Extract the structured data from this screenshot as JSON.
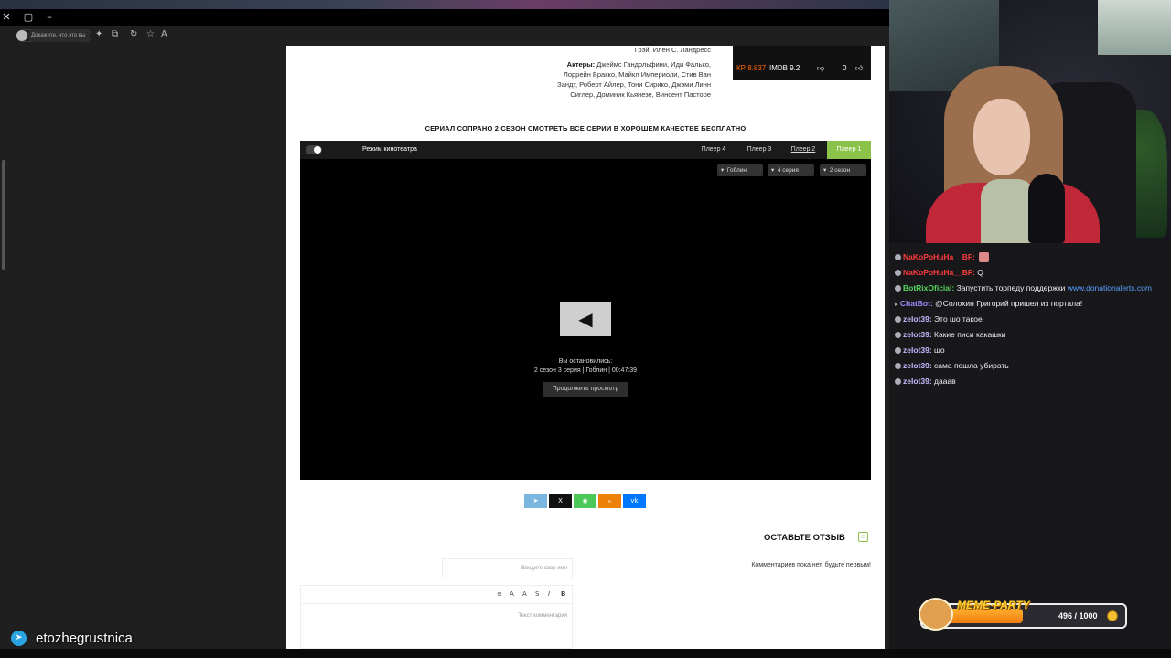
{
  "browser": {
    "address_pill": "Докажите, что это вы",
    "window_close": "✕",
    "window_restore": "▢",
    "window_minimize": "–"
  },
  "movie": {
    "director_line": "Грэй, Илен С. Ландресс",
    "actors_label": "Актеры:",
    "actors_line1": "Джеймс Гандольфини, Иди Фалько,",
    "actors_line2": "Лоррейн Бракко, Майкл Империоли, Стив Ван",
    "actors_line3": "Зандт, Роберт Айлер, Тони Сирико, Джэми Линн",
    "actors_line4": "Сиглер, Доминик Кьянезе, Винсент Пасторе",
    "ratings": {
      "likes": "0",
      "imdb": "IMDB 9.2",
      "kp": "КР 8.837"
    }
  },
  "section_title": "СЕРИАЛ СОПРАНО 2 СЕЗОН СМОТРЕТЬ ВСЕ СЕРИИ В ХОРОШЕМ КАЧЕСТВЕ БЕСПЛАТНО",
  "player": {
    "tabs": [
      "Плеер 1",
      "Плеер 2",
      "Плеер 3",
      "Плеер 4"
    ],
    "cinema_mode": "Режим кинотеатра",
    "season": "2 сезон",
    "episode": "4 серия",
    "voice": "Гоблин",
    "stopped_line1": "Вы остановились:",
    "stopped_line2": "2 сезон 3 серия | Гоблин | 00:47:39",
    "continue": "Продолжить просмотр"
  },
  "share": [
    "vk",
    "ok",
    "whatsapp",
    "x",
    "telegram"
  ],
  "review": {
    "title": "ОСТАВЬТЕ ОТЗЫВ",
    "no_comments": "Комментариев пока нет, будьте первым!",
    "name_placeholder": "Введите свое имя",
    "comment_placeholder": "Текст комментария",
    "toolbar": [
      "B",
      "I",
      "S",
      "A",
      "A",
      "≡"
    ]
  },
  "telegram_handle": "etozhegrustnica",
  "chat": [
    {
      "user": "NaKoPoHuHa__BF:",
      "text": "",
      "color": "#ff3b3b"
    },
    {
      "user": "NaKoPoHuHa__BF:",
      "text": "Q",
      "color": "#ff3b3b"
    },
    {
      "user": "BotRixOficial:",
      "text": "Запустить торпеду поддержки ",
      "link": "www.donationalerts.com",
      "color": "#59d65b"
    },
    {
      "user": "ChatBot:",
      "text": "@Солохин Григорий пришел из портала!",
      "color": "#9b8cff"
    },
    {
      "user": "zelot39:",
      "text": "Это шо такое",
      "color": "#c7b8ff"
    },
    {
      "user": "zelot39:",
      "text": "Какие писи какашки",
      "color": "#c7b8ff"
    },
    {
      "user": "zelot39:",
      "text": "шо",
      "color": "#c7b8ff"
    },
    {
      "user": "zelot39:",
      "text": "сама пошла убирать",
      "color": "#c7b8ff"
    },
    {
      "user": "zelot39:",
      "text": "дааав",
      "color": "#c7b8ff"
    }
  ],
  "meme_party": {
    "title": "MEME·PARTY",
    "progress_text": "496 / 1000",
    "progress_fraction": 0.496
  },
  "colors": {
    "player_active_tab": "#8bc34a",
    "kp": "#ff6600",
    "vk": "#0077ff",
    "ok": "#ee8208",
    "whatsapp": "#4ac959",
    "x": "#111111",
    "telegram": "#7ab6e0"
  }
}
